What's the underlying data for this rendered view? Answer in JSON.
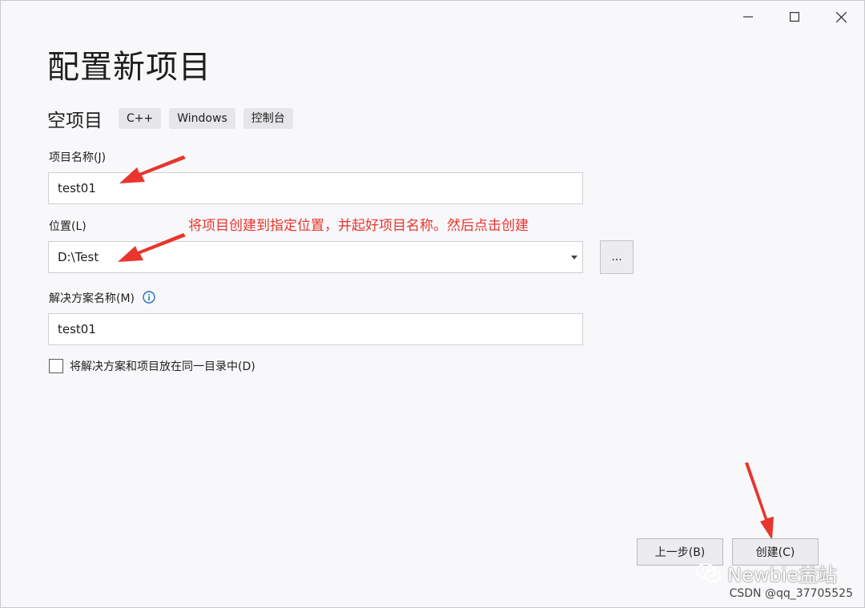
{
  "window": {
    "controls": [
      "minimize-icon",
      "maximize-icon",
      "close-icon"
    ]
  },
  "header": {
    "title": "配置新项目",
    "template_name": "空项目",
    "tags": [
      "C++",
      "Windows",
      "控制台"
    ]
  },
  "form": {
    "project_name_label": "项目名称(J)",
    "project_name_value": "test01",
    "location_label": "位置(L)",
    "location_value": "D:\\Test",
    "browse_label": "...",
    "solution_name_label": "解决方案名称(M)",
    "solution_name_value": "test01",
    "same_dir_label": "将解决方案和项目放在同一目录中(D)",
    "same_dir_checked": false
  },
  "annotation": {
    "text": "将项目创建到指定位置，并起好项目名称。然后点击创建",
    "color": "#e8352d"
  },
  "footer": {
    "back_label": "上一步(B)",
    "create_label": "创建(C)"
  },
  "watermark": {
    "brand": "Newbie益站",
    "credit": "CSDN @qq_37705525"
  }
}
